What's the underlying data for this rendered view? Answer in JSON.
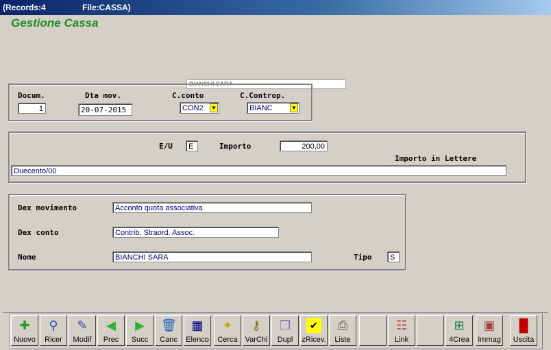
{
  "window": {
    "records": "(Records:4",
    "file": "File:CASSA)"
  },
  "app_title": "Gestione Cassa",
  "float_name": "BIANCHI SARA",
  "header": {
    "docum_label": "Docum.",
    "docum_value": "1",
    "dta_label": "Dta mov.",
    "dta_value": "20-07-2015",
    "cconto_label": "C.conto",
    "cconto_value": "CON2",
    "ccontrop_label": "C.Controp.",
    "ccontrop_value": "BIANC"
  },
  "amount": {
    "eu_label": "E/U",
    "eu_value": "E",
    "importo_label": "Importo",
    "importo_value": "200,00",
    "lettere_label": "Importo in Lettere",
    "lettere_value": "Duecento/00"
  },
  "details": {
    "dexmov_label": "Dex movimento",
    "dexmov_value": "Acconto quota associativa",
    "dexconto_label": "Dex conto",
    "dexconto_value": "Contrib. Straord. Assoc.",
    "nome_label": "Nome",
    "nome_value": "BIANCHI SARA",
    "tipo_label": "Tipo",
    "tipo_value": "S"
  },
  "toolbar": {
    "nuovo": "Nuovo",
    "ricer": "Ricer",
    "modif": "Modif",
    "prec": "Prec",
    "succ": "Succ",
    "canc": "Canc",
    "elenco": "Elenco",
    "cerca": "Cerca",
    "varchi": "VarChi",
    "dupl": "Dupl",
    "zricev": "zRicev.",
    "liste": "Liste",
    "link": "Link",
    "crea": "4Crea",
    "immag": "Immag",
    "uscita": "Uscita"
  },
  "colors": {
    "title_green": "#1e8c1e",
    "titlebar": "#0a246a",
    "combo_button": "#ffff00",
    "value_text": "#000080"
  }
}
